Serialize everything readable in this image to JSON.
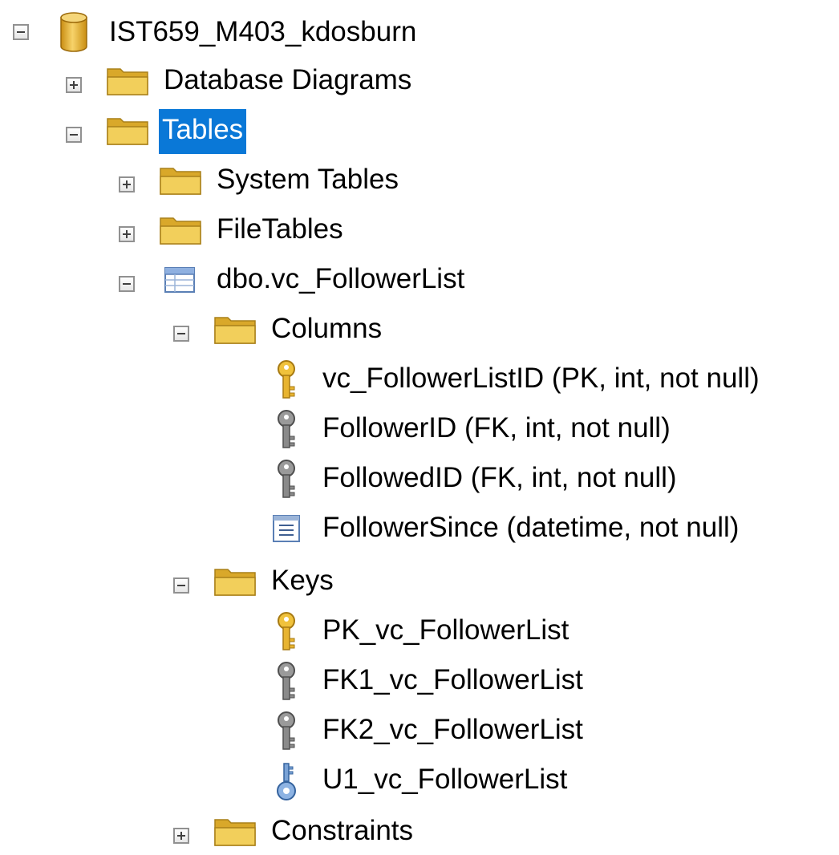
{
  "tree": {
    "database": {
      "label": "IST659_M403_kdosburn",
      "icon": "database-icon",
      "expanded": true
    },
    "database_diagrams": {
      "label": "Database Diagrams",
      "icon": "folder-icon",
      "expanded": false
    },
    "tables": {
      "label": "Tables",
      "icon": "folder-icon",
      "expanded": true,
      "selected": true
    },
    "system_tables": {
      "label": "System Tables",
      "icon": "folder-icon",
      "expanded": false
    },
    "file_tables": {
      "label": "FileTables",
      "icon": "folder-icon",
      "expanded": false
    },
    "table": {
      "label": "dbo.vc_FollowerList",
      "icon": "table-icon",
      "expanded": true
    },
    "columns_folder": {
      "label": "Columns",
      "icon": "folder-icon",
      "expanded": true
    },
    "columns": [
      {
        "label": "vc_FollowerListID (PK, int, not null)",
        "icon": "primary-key-icon"
      },
      {
        "label": "FollowerID (FK, int, not null)",
        "icon": "foreign-key-icon"
      },
      {
        "label": "FollowedID (FK, int, not null)",
        "icon": "foreign-key-icon"
      },
      {
        "label": "FollowerSince (datetime, not null)",
        "icon": "column-icon"
      }
    ],
    "keys_folder": {
      "label": "Keys",
      "icon": "folder-icon",
      "expanded": true
    },
    "keys": [
      {
        "label": "PK_vc_FollowerList",
        "icon": "primary-key-icon"
      },
      {
        "label": "FK1_vc_FollowerList",
        "icon": "foreign-key-icon"
      },
      {
        "label": "FK2_vc_FollowerList",
        "icon": "foreign-key-icon"
      },
      {
        "label": "U1_vc_FollowerList",
        "icon": "unique-key-icon"
      }
    ],
    "constraints_folder": {
      "label": "Constraints",
      "icon": "folder-icon",
      "expanded": false
    }
  },
  "colors": {
    "selection": "#0a78d7",
    "folder": "#e8c23e",
    "primary_key": "#e8b430",
    "foreign_key": "#8a8a8a",
    "unique_key": "#5b8fc9",
    "database": "#e9b53a"
  }
}
